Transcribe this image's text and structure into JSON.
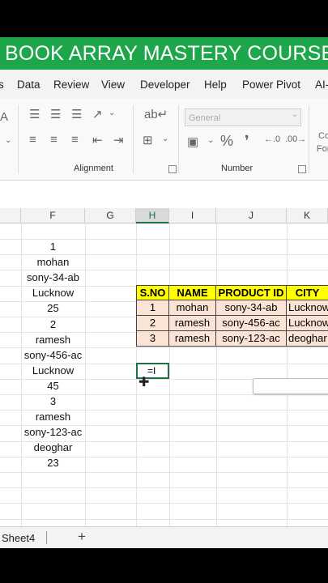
{
  "banner": {
    "title": "BOOK ARRAY MASTERY COURSE"
  },
  "menu": {
    "items": [
      "s",
      "Data",
      "Review",
      "View",
      "Developer",
      "Help",
      "Power Pivot",
      "AI-"
    ]
  },
  "ribbon": {
    "alignment_label": "Alignment",
    "number_label": "Number",
    "number_format": "General",
    "font_partial": "A",
    "cond_partial": "Co",
    "fmt_partial": "For"
  },
  "grid": {
    "columns": [
      "F",
      "G",
      "H",
      "I",
      "J",
      "K"
    ],
    "selected_column": "H",
    "column_f_values": [
      "1",
      "mohan",
      "sony-34-ab",
      "Lucknow",
      "25",
      "2",
      "ramesh",
      "sony-456-ac",
      "Lucknow",
      "45",
      "3",
      "ramesh",
      "sony-123-ac",
      "deoghar",
      "23"
    ],
    "table": {
      "headers": [
        "S.NO",
        "NAME",
        "PRODUCT ID",
        "CITY"
      ],
      "rows": [
        [
          "1",
          "mohan",
          "sony-34-ab",
          "Lucknow"
        ],
        [
          "2",
          "ramesh",
          "sony-456-ac",
          "Lucknow"
        ],
        [
          "3",
          "ramesh",
          "sony-123-ac",
          "deoghar"
        ]
      ]
    },
    "active_cell_text": "=I"
  },
  "sheets": {
    "tab_label": "Sheet4",
    "add_label": "+"
  },
  "colors": {
    "banner": "#1ea64a",
    "header_fill": "#ffff00",
    "row_fill": "#fbe4d5",
    "accent": "#1e7145"
  }
}
